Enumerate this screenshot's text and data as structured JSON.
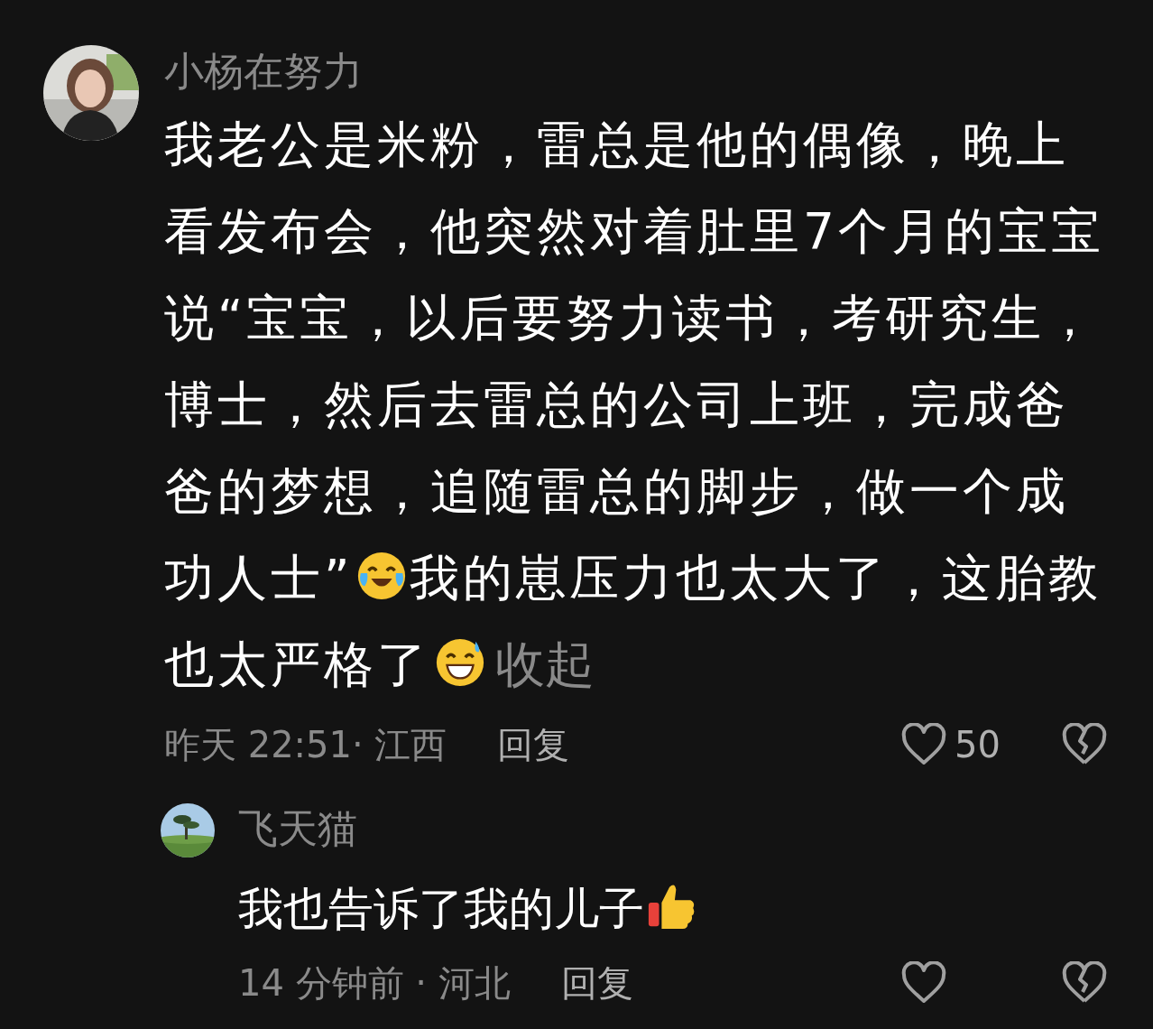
{
  "comments": [
    {
      "author": "小杨在努力",
      "body": [
        {
          "kind": "text",
          "text": "我老公是米粉，雷总是他的偶像，晚上看发布会，他突然对着肚里7个月的宝宝说“宝宝，以后要努力读书，考研究生，博士，然后去雷总的公司上班，完成爸爸的梦想，追随雷总的脚步，做一个成功人士”"
        },
        {
          "kind": "emoji-cry"
        },
        {
          "kind": "text",
          "text": "我的崽压力也太大了，这胎教也太严格了"
        },
        {
          "kind": "emoji-sweat"
        }
      ],
      "collapse": "收起",
      "time": "昨天 22:51· 江西",
      "reply": "回复",
      "likes": "50",
      "liked": false,
      "reply_level": false
    },
    {
      "author": "飞天猫",
      "body": [
        {
          "kind": "text",
          "text": "我也告诉了我的儿子"
        },
        {
          "kind": "emoji-thumb"
        }
      ],
      "time": "14 分钟前 · 河北",
      "reply": "回复",
      "liked": false,
      "reply_level": true
    }
  ]
}
